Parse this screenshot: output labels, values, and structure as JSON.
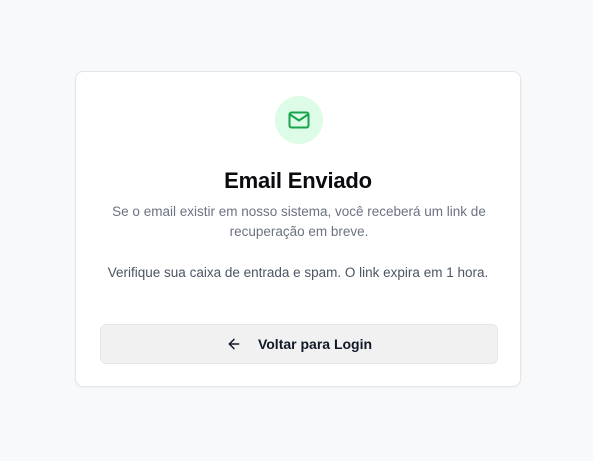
{
  "card": {
    "title": "Email Enviado",
    "subtitle": "Se o email existir em nosso sistema, você receberá um link de recuperação em breve.",
    "note": "Verifique sua caixa de entrada e spam. O link expira em 1 hora.",
    "icon": "mail-icon",
    "back_button": {
      "label": "Voltar para Login",
      "icon": "arrow-left-icon"
    }
  },
  "colors": {
    "accent": "#16a34a",
    "accent_bg": "#dcfce7",
    "page_bg": "#f8f9fb",
    "button_bg": "#f1f1f2"
  }
}
